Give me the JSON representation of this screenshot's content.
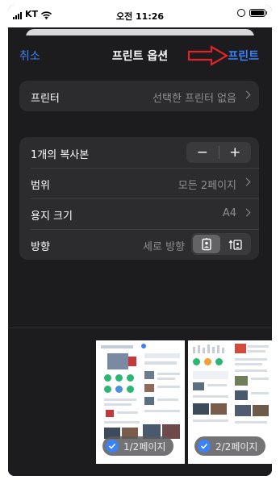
{
  "status_bar": {
    "carrier": "KT",
    "time": "오전 11:26"
  },
  "nav": {
    "cancel": "취소",
    "title": "프린트 옵션",
    "print": "프린트"
  },
  "printer": {
    "label": "프린터",
    "value": "선택한 프린터 없음"
  },
  "settings": {
    "copies_label": "1개의 복사본",
    "range_label": "범위",
    "range_value": "모든 2페이지",
    "paper_label": "용지 크기",
    "paper_value": "A4",
    "orientation_label": "방향",
    "orientation_value": "세로 방향"
  },
  "stepper": {
    "minus": "−",
    "plus": "+"
  },
  "previews": [
    {
      "label": "1/2페이지",
      "selected": true
    },
    {
      "label": "2/2페이지",
      "selected": true
    }
  ],
  "colors": {
    "accent": "#3a82f7",
    "annotation_arrow": "#e0232a",
    "sheet_background": "#1c1c1e"
  },
  "icons": [
    "signal-bars-icon",
    "wifi-icon",
    "rotation-lock-icon",
    "battery-icon",
    "chevron-right-icon",
    "minus-icon",
    "plus-icon",
    "portrait-icon",
    "landscape-icon",
    "checkmark-icon"
  ]
}
